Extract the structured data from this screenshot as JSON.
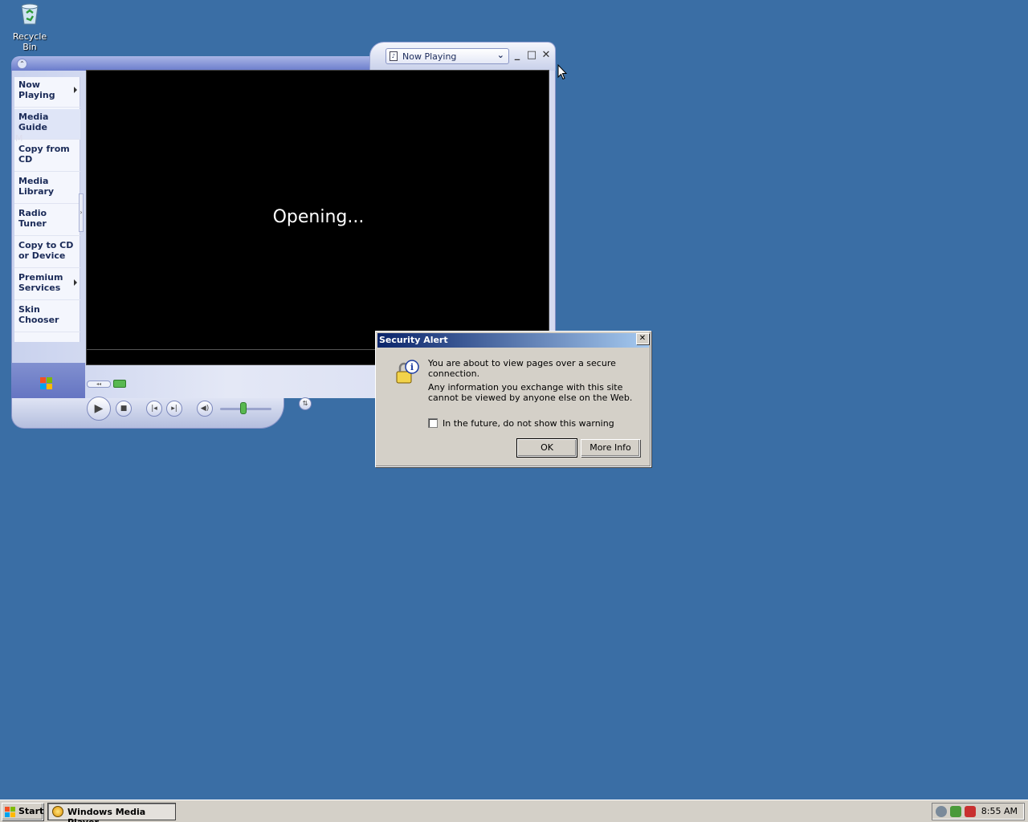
{
  "desktop": {
    "recycle_bin_label": "Recycle Bin"
  },
  "player": {
    "menu_button_icon": "chevron-icon",
    "view_selector": "Now Playing",
    "side_letter": "M",
    "taskpane": [
      {
        "label": "Now Playing",
        "has_arrow": true
      },
      {
        "label": "Media Guide",
        "active": true
      },
      {
        "label": "Copy from CD"
      },
      {
        "label": "Media Library"
      },
      {
        "label": "Radio Tuner"
      },
      {
        "label": "Copy to CD or Device"
      },
      {
        "label": "Premium Services",
        "has_arrow": true
      },
      {
        "label": "Skin Chooser"
      }
    ],
    "status_text": "Opening...",
    "volume_level": 0.45
  },
  "dialog": {
    "title": "Security Alert",
    "line1": "You are about to view pages over a secure connection.",
    "line2": "Any information you exchange with this site cannot be viewed by anyone else on the Web.",
    "checkbox_label": "In the future, do not show this warning",
    "checkbox_checked": false,
    "ok_label": "OK",
    "more_info_label": "More Info"
  },
  "taskbar": {
    "start_label": "Start",
    "task_label": "Windows Media Player",
    "clock": "8:55 AM"
  },
  "colors": {
    "desktop": "#3a6ea5",
    "titlebar_start": "#0a246a",
    "titlebar_end": "#a6caf0"
  }
}
